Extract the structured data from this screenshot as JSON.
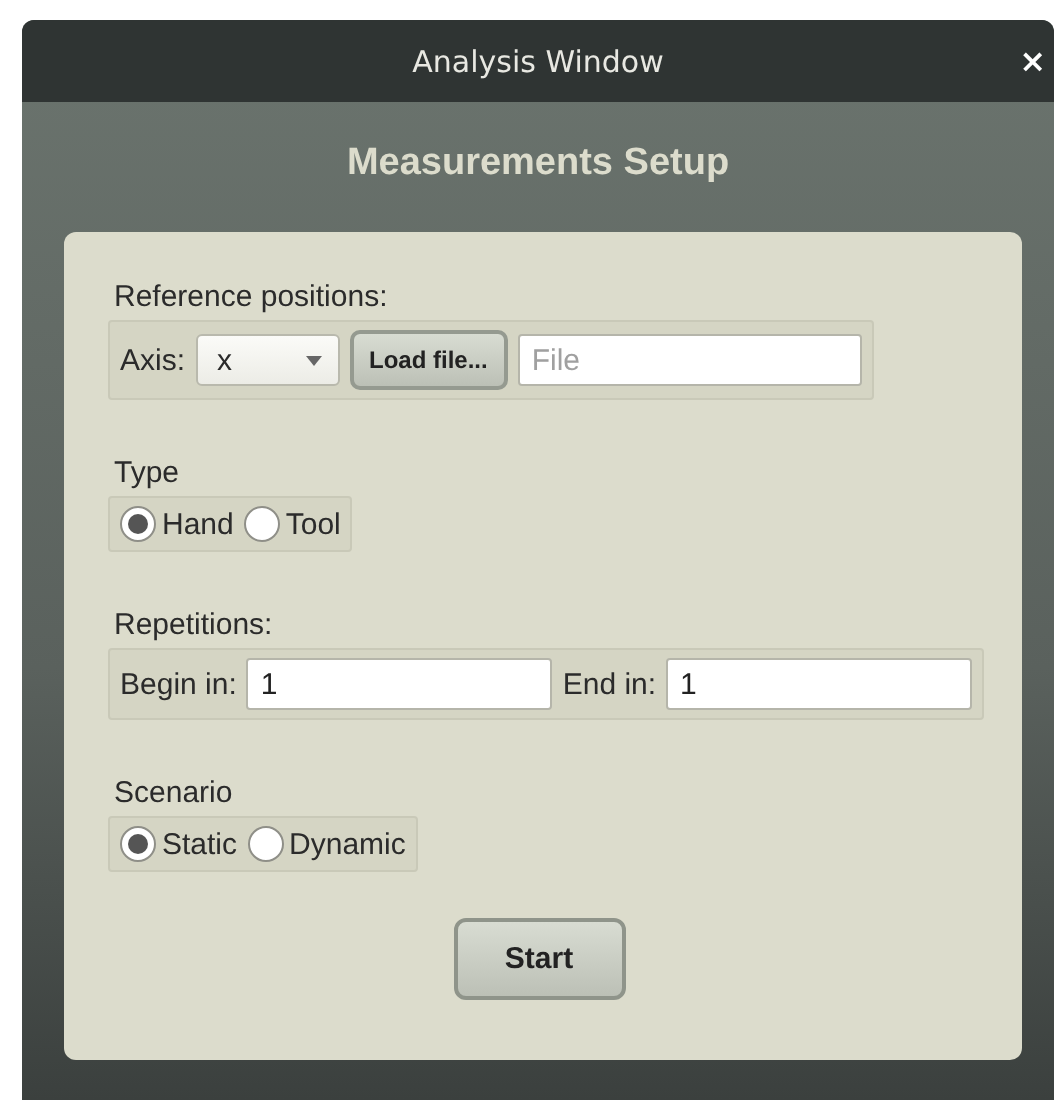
{
  "window": {
    "title": "Analysis Window",
    "close": "×"
  },
  "heading": "Measurements Setup",
  "sections": [
    {
      "kind": "axis",
      "label": "Reference positions:",
      "axis_label": "Axis:",
      "axis_value": "x",
      "load_button": "Load file...",
      "file_placeholder": "File"
    },
    {
      "kind": "radio",
      "label": "Type",
      "options": [
        {
          "label": "Hand",
          "selected": true
        },
        {
          "label": "Tool",
          "selected": false
        }
      ]
    },
    {
      "kind": "range",
      "label": "Repetitions:",
      "begin_label": "Begin in:",
      "begin_value": "1",
      "end_label": "End in:",
      "end_value": "1"
    },
    {
      "kind": "radio",
      "label": "Scenario",
      "options": [
        {
          "label": "Static",
          "selected": true
        },
        {
          "label": "Dynamic",
          "selected": false
        }
      ]
    }
  ],
  "start_button": "Start"
}
